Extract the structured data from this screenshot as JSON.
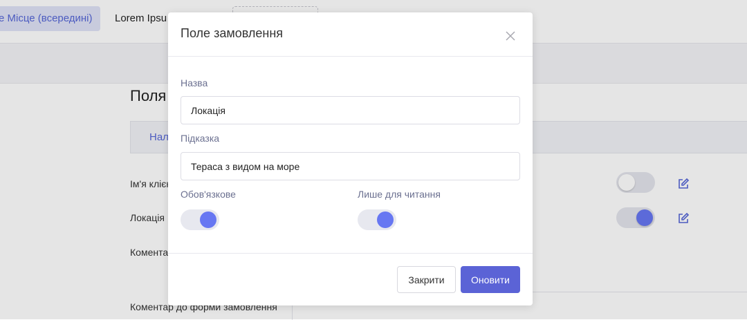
{
  "background": {
    "top_tabs": [
      {
        "label": "е Місце (всередині)"
      },
      {
        "label": "Lorem Ipsu"
      }
    ],
    "page_title": "Поля",
    "tab_label": "Нала",
    "rows": [
      {
        "label": "Ім'я клієнт",
        "toggle_on": false
      },
      {
        "label": "Локація",
        "toggle_on": true
      },
      {
        "label": "Комента"
      }
    ],
    "bottom_label": "Коментар до форми замовлення"
  },
  "modal": {
    "title": "Поле замовлення",
    "name_label": "Назва",
    "name_value": "Локація",
    "hint_label": "Підказка",
    "hint_value": "Тераса з видом на море",
    "required_label": "Обов'язкове",
    "required_on": true,
    "readonly_label": "Лише для читання",
    "readonly_on": true,
    "close_button": "Закрити",
    "update_button": "Оновити"
  },
  "colors": {
    "accent": "#5b63d6",
    "toggle_knob": "#6777f2"
  }
}
